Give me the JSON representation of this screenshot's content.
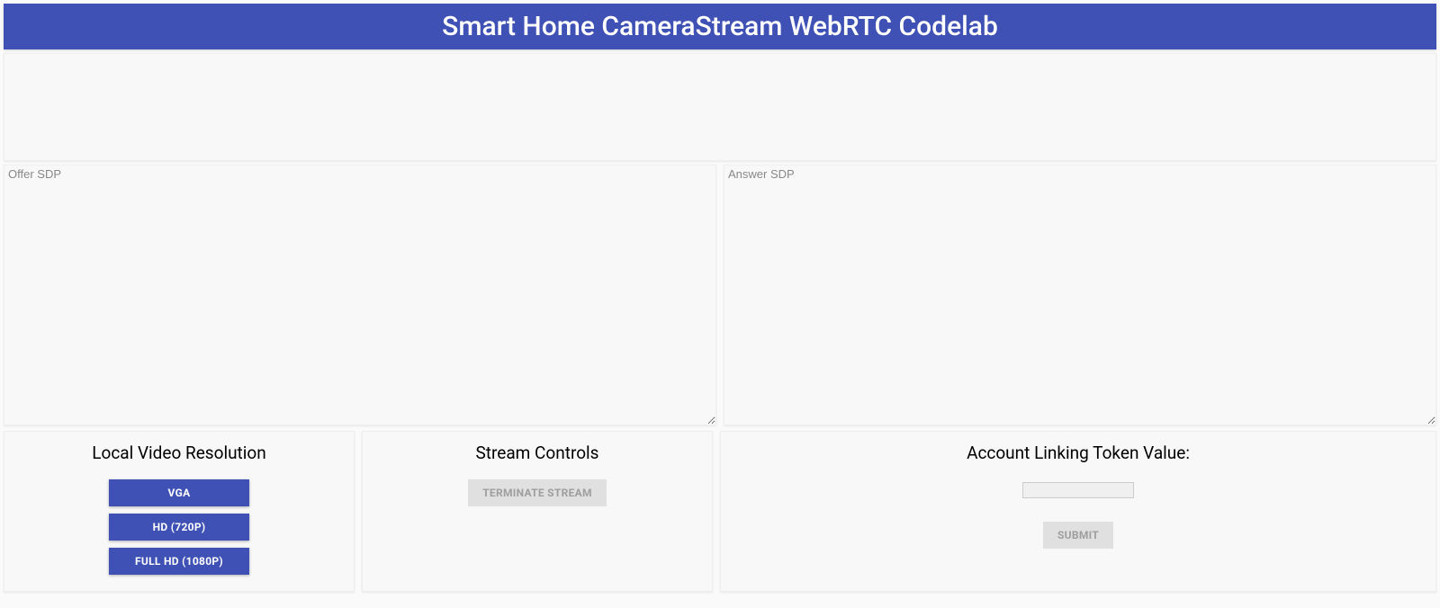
{
  "header": {
    "title": "Smart Home CameraStream WebRTC Codelab"
  },
  "sdp": {
    "offer_placeholder": "Offer SDP",
    "offer_value": "",
    "answer_placeholder": "Answer SDP",
    "answer_value": ""
  },
  "resolution": {
    "title": "Local Video Resolution",
    "buttons": [
      {
        "label": "VGA"
      },
      {
        "label": "HD (720P)"
      },
      {
        "label": "FULL HD (1080P)"
      }
    ]
  },
  "stream": {
    "title": "Stream Controls",
    "terminate_label": "TERMINATE STREAM"
  },
  "token": {
    "title": "Account Linking Token Value:",
    "input_value": "",
    "submit_label": "SUBMIT"
  }
}
